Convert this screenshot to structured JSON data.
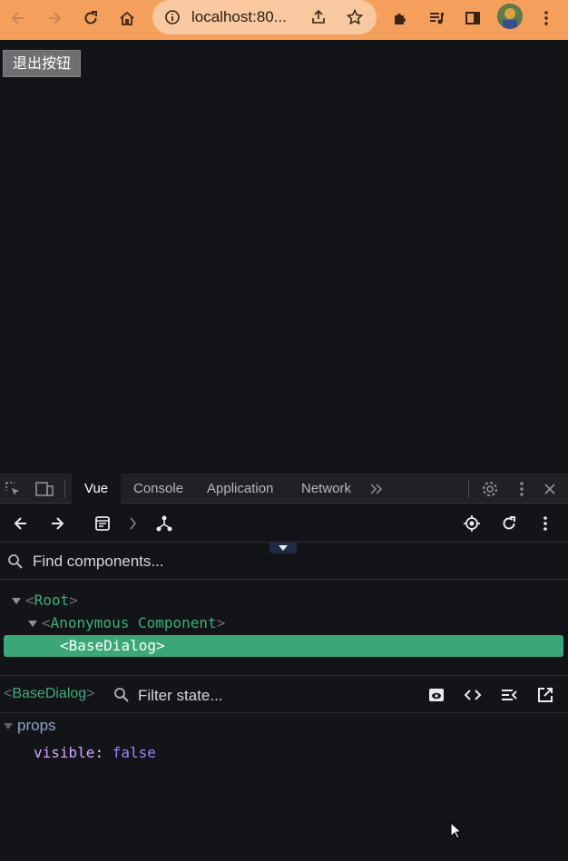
{
  "browser": {
    "url": "localhost:80...",
    "colors": {
      "bar": "#f4a05c",
      "omnibox": "#f8c9a0"
    }
  },
  "page": {
    "exit_button_label": "退出按钮"
  },
  "devtools": {
    "tabs": [
      {
        "label": "Vue",
        "active": true
      },
      {
        "label": "Console",
        "active": false
      },
      {
        "label": "Application",
        "active": false
      },
      {
        "label": "Network",
        "active": false
      }
    ],
    "search_placeholder": "Find components...",
    "tree": [
      {
        "name": "Root",
        "depth": 0,
        "expanded": true,
        "selected": false
      },
      {
        "name": "Anonymous Component",
        "depth": 1,
        "expanded": true,
        "selected": false
      },
      {
        "name": "BaseDialog",
        "depth": 2,
        "expanded": false,
        "selected": true
      }
    ],
    "inspector": {
      "component": "BaseDialog",
      "filter_placeholder": "Filter state...",
      "section": "props",
      "props": [
        {
          "key": "visible",
          "value": "false"
        }
      ]
    },
    "colors": {
      "accent": "#3eaf7c",
      "selected_row": "#3ba776"
    }
  }
}
